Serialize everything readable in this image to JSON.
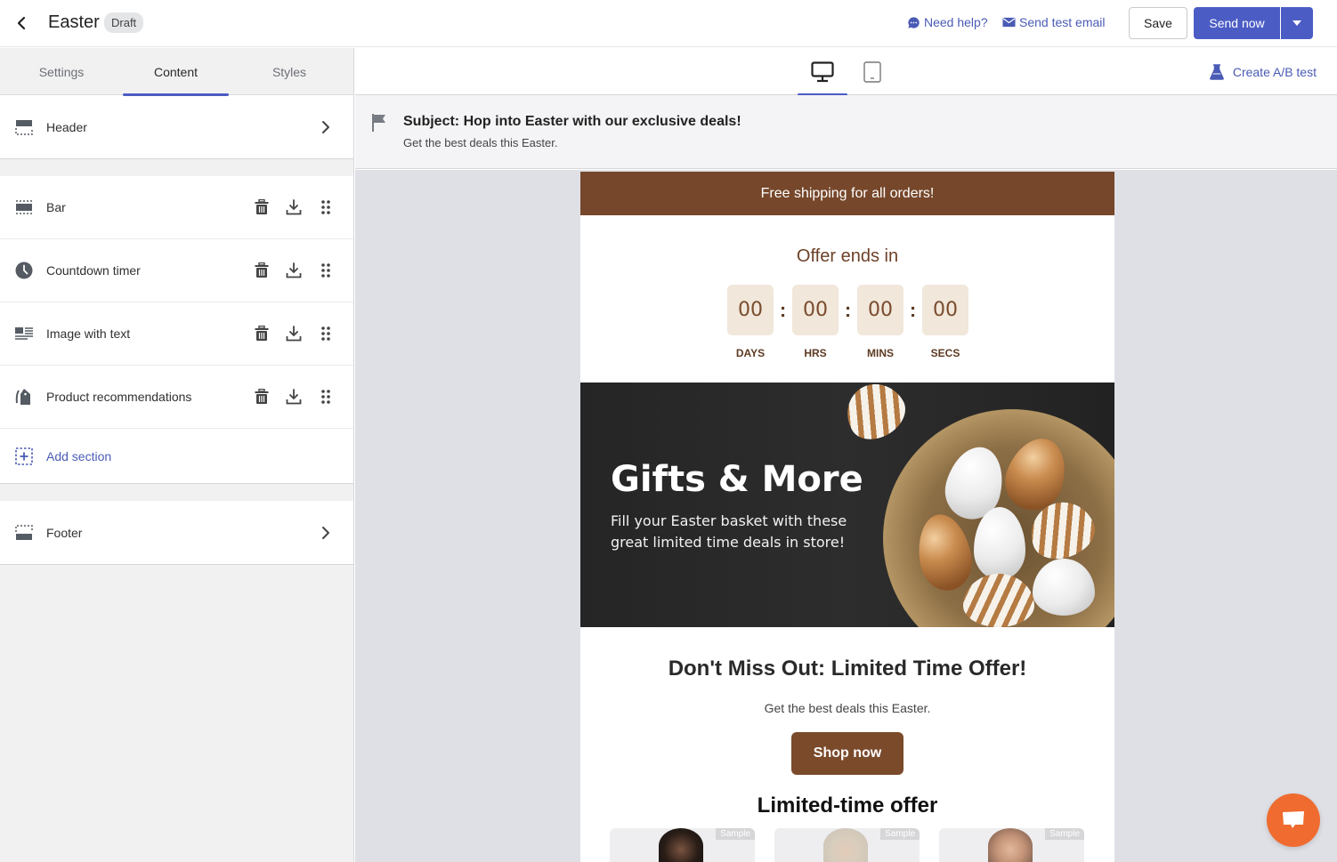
{
  "topbar": {
    "title": "Easter",
    "status_badge": "Draft",
    "need_help": "Need help?",
    "send_test_email": "Send test email",
    "save": "Save",
    "send_now": "Send now"
  },
  "left_panel": {
    "tabs": [
      {
        "label": "Settings",
        "active": false
      },
      {
        "label": "Content",
        "active": true
      },
      {
        "label": "Styles",
        "active": false
      }
    ],
    "header_section": {
      "label": "Header",
      "icon": "layout-header-icon"
    },
    "sections": [
      {
        "label": "Bar",
        "icon": "layout-bar-icon"
      },
      {
        "label": "Countdown timer",
        "icon": "clock-icon"
      },
      {
        "label": "Image with text",
        "icon": "image-text-icon"
      },
      {
        "label": "Product recommendations",
        "icon": "tag-icon"
      }
    ],
    "add_section": "Add section",
    "footer_section": {
      "label": "Footer",
      "icon": "layout-footer-icon"
    }
  },
  "preview": {
    "devices": [
      {
        "name": "desktop",
        "active": true
      },
      {
        "name": "mobile",
        "active": false
      }
    ],
    "create_ab_test": "Create A/B test",
    "subject": "Subject: Hop into Easter with our exclusive deals!",
    "preheader": "Get the best deals this Easter."
  },
  "email": {
    "colors": {
      "brand_brown": "#76472a",
      "timer_bg": "#f1e7da",
      "accent": "#4b5cc4"
    },
    "bar_text": "Free shipping for all orders!",
    "countdown": {
      "title": "Offer ends in",
      "units": [
        {
          "value": "00",
          "label": "DAYS"
        },
        {
          "value": "00",
          "label": "HRS"
        },
        {
          "value": "00",
          "label": "MINS"
        },
        {
          "value": "00",
          "label": "SECS"
        }
      ],
      "separator": ":"
    },
    "hero": {
      "title": "Gifts & More",
      "text": "Fill your Easter basket with these great limited time deals in store!"
    },
    "cta": {
      "title": "Don't Miss Out: Limited Time Offer!",
      "subtitle": "Get the best deals this Easter.",
      "button": "Shop now"
    },
    "products": {
      "title": "Limited-time offer",
      "items": [
        {
          "tag": "Sample"
        },
        {
          "tag": "Sample"
        },
        {
          "tag": "Sample"
        }
      ]
    }
  }
}
